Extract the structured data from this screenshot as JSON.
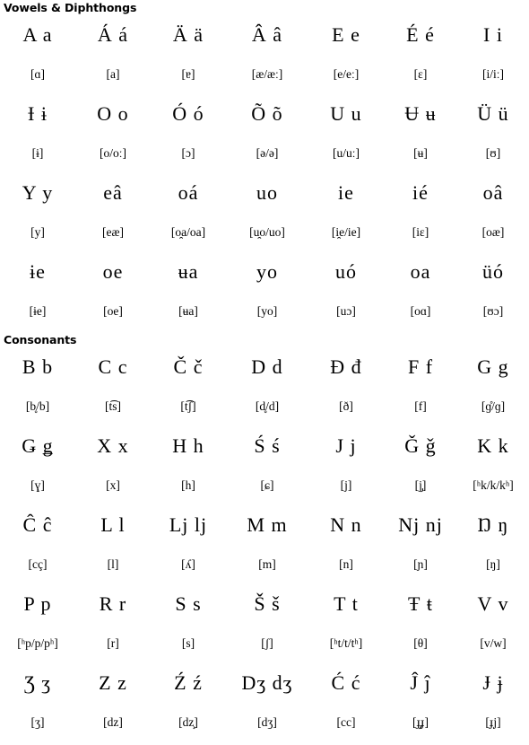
{
  "sections": [
    {
      "id": "vowels",
      "heading": "Vowels & Diphthongs",
      "rows": [
        {
          "letters": [
            "A a",
            "Á á",
            "Ä ä",
            "Â â",
            "E e",
            "É é",
            "I i"
          ],
          "ipa": [
            "[ɑ]",
            "[a]",
            "[ɐ]",
            "[æ/æː]",
            "[e/eː]",
            "[ɛ]",
            "[i/iː]"
          ]
        },
        {
          "letters": [
            "Ɨ ɨ",
            "O o",
            "Ó ó",
            "Õ õ",
            "U u",
            "Ʉ ʉ",
            "Ü ü"
          ],
          "ipa": [
            "[ɨ]",
            "[o/oː]",
            "[ɔ]",
            "[ə/ə]",
            "[u/uː]",
            "[ʉ]",
            "[ʊ]"
          ]
        },
        {
          "letters": [
            "Y y",
            "eâ",
            "oá",
            "uo",
            "ie",
            "ié",
            "oâ"
          ],
          "ipa": [
            "[y]",
            "[eæ]",
            "[o̯a/oa]",
            "[u̯o/uo]",
            "[i̯e/ie]",
            "[iɛ]",
            "[oæ]"
          ]
        },
        {
          "letters": [
            "ɨe",
            "oe",
            "ʉa",
            "yo",
            "uó",
            "oa",
            "üó"
          ],
          "ipa": [
            "[ɨe]",
            "[oe]",
            "[ʉa]",
            "[yo]",
            "[uɔ]",
            "[oɑ]",
            "[ʊɔ]"
          ]
        }
      ]
    },
    {
      "id": "consonants",
      "heading": "Consonants",
      "rows": [
        {
          "letters": [
            "B b",
            "C c",
            "Č č",
            "D d",
            "Đ đ",
            "F f",
            "G g"
          ],
          "ipa": [
            "[b̥/b]",
            "[t͡s]",
            "[t͡ʃ]",
            "[d̥/d]",
            "[ð]",
            "[f]",
            "[ɡ̊/ɡ]"
          ]
        },
        {
          "letters": [
            "Ǥ ǥ",
            "X x",
            "H h",
            "Ś ś",
            "J j",
            "Ǧ ǧ",
            "K k"
          ],
          "ipa": [
            "[ɣ]",
            "[x]",
            "[h]",
            "[ɕ]",
            "[j]",
            "[j̡]",
            "[ʰk/k/kʰ]"
          ]
        },
        {
          "letters": [
            "Ĉ ĉ",
            "L l",
            "Lj lj",
            "M m",
            "N n",
            "Nj nj",
            "Ŋ ŋ"
          ],
          "ipa": [
            "[cç]",
            "[l]",
            "[ʎ]",
            "[m]",
            "[n]",
            "[ɲ]",
            "[ŋ]"
          ]
        },
        {
          "letters": [
            "P p",
            "R r",
            "S s",
            "Š š",
            "T t",
            "Ŧ ŧ",
            "V v"
          ],
          "ipa": [
            "[ʰp/p/pʰ]",
            "[r]",
            "[s]",
            "[ʃ]",
            "[ʰt/t/tʰ]",
            "[θ]",
            "[v/w]"
          ]
        },
        {
          "letters": [
            "Ʒ ʒ",
            "Z z",
            "Ź ź",
            "Dʒ dʒ",
            "Ć ć",
            "Ĵ ĵ",
            "Ɉ ɉ"
          ],
          "ipa": [
            "[ʒ]",
            "[dz]",
            "[dz̧]",
            "[dʒ]",
            "[cc]",
            "[ɟ̡ɟ]",
            "[ɟ̩j]"
          ]
        }
      ]
    }
  ]
}
